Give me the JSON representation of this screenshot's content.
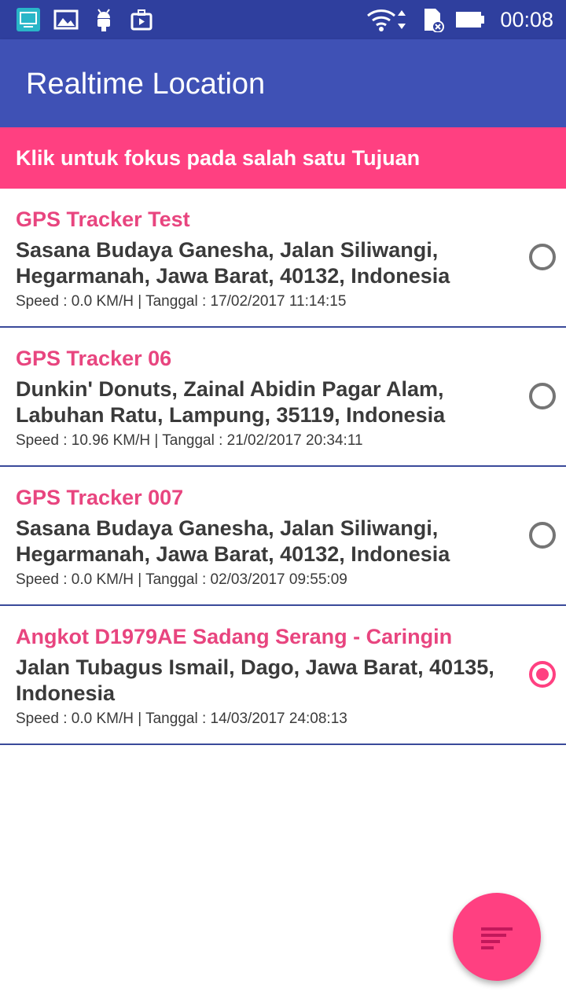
{
  "status_bar": {
    "icons": [
      "cast-screen-icon",
      "image-icon",
      "android-icon",
      "briefcase-play-icon",
      "wifi-icon",
      "sd-card-icon",
      "battery-icon"
    ],
    "time": "00:08"
  },
  "app_bar": {
    "title": "Realtime Location"
  },
  "banner": {
    "text": "Klik untuk fokus pada salah satu Tujuan"
  },
  "items": [
    {
      "name": "GPS Tracker Test",
      "address": "Sasana Budaya Ganesha, Jalan Siliwangi, Hegarmanah, Jawa Barat, 40132, Indonesia",
      "meta": "Speed : 0.0 KM/H | Tanggal : 17/02/2017 11:14:15",
      "selected": false
    },
    {
      "name": "GPS Tracker 06",
      "address": "Dunkin' Donuts, Zainal Abidin Pagar Alam, Labuhan Ratu, Lampung, 35119, Indonesia",
      "meta": "Speed : 10.96 KM/H | Tanggal : 21/02/2017 20:34:11",
      "selected": false
    },
    {
      "name": "GPS Tracker 007",
      "address": "Sasana Budaya Ganesha, Jalan Siliwangi, Hegarmanah, Jawa Barat, 40132, Indonesia",
      "meta": "Speed : 0.0 KM/H | Tanggal : 02/03/2017 09:55:09",
      "selected": false
    },
    {
      "name": "Angkot D1979AE Sadang Serang - Caringin",
      "address": "Jalan Tubagus Ismail, Dago, Jawa Barat, 40135, Indonesia",
      "meta": "Speed : 0.0 KM/H | Tanggal : 14/03/2017 24:08:13",
      "selected": true
    }
  ],
  "fab": {
    "icon": "sort-icon"
  },
  "colors": {
    "primary": "#3f51b5",
    "primary_dark": "#2f3f9e",
    "accent": "#ff4081",
    "item_name": "#e8457f"
  }
}
